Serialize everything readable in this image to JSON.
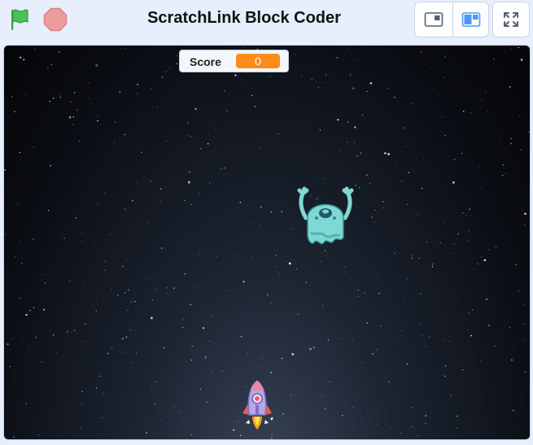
{
  "app": {
    "title": "ScratchLink Block Coder"
  },
  "toolbar": {
    "green_flag_icon": "green-flag-icon",
    "stop_icon": "stop-sign-icon",
    "small_stage_icon": "small-stage-icon",
    "large_stage_icon": "large-stage-icon",
    "fullscreen_icon": "fullscreen-icon"
  },
  "stage": {
    "backdrop": "starry-space",
    "monitor": {
      "label": "Score",
      "value": "0"
    },
    "sprites": [
      {
        "name": "ghost-monster",
        "icon": "ghost-monster-sprite"
      },
      {
        "name": "rocketship",
        "icon": "rocketship-sprite"
      }
    ]
  },
  "colors": {
    "flag": "#4cbf56",
    "stop": "#ec9c9c",
    "monitor_value": "#ff8c1a",
    "layout_active": "#4c97ff",
    "ghost": "#7fd8d2",
    "rocket_body": "#b3a9e8",
    "rocket_fins": "#f05a55"
  }
}
